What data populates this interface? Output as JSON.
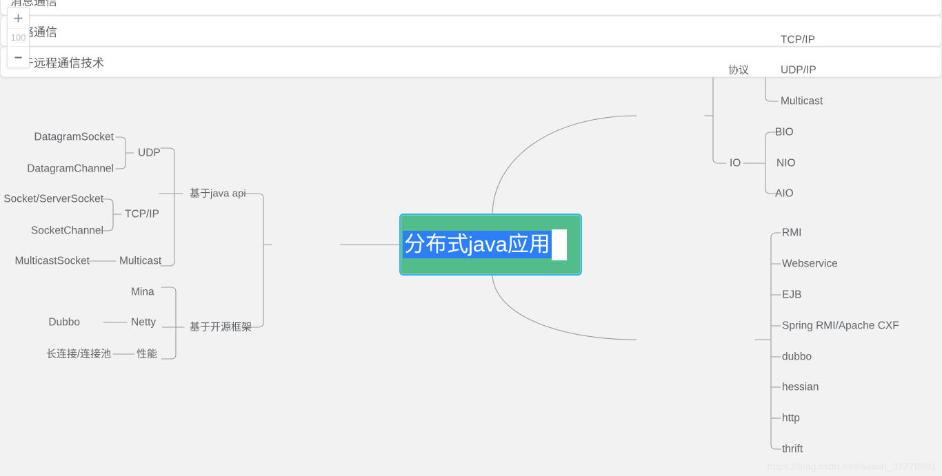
{
  "app": {
    "background_color": "#f2f2f2",
    "line_color": "#9a9a9a",
    "text_color": "#606468"
  },
  "zoom_control": {
    "zoom_in_label": "+",
    "zoom_level": "100",
    "zoom_out_label": "−",
    "zoom_in_icon": "plus-icon",
    "zoom_out_icon": "minus-icon"
  },
  "root": {
    "text": "分布式java应用",
    "state": "editing-selected",
    "fill_color": "#52bd8a",
    "border_color": "#2fb4ef",
    "selection_color": "#2d7ff9",
    "text_color": "#ffffff"
  },
  "branches": [
    {
      "id": "message-communication",
      "label": "消息通信",
      "side": "left",
      "style": "box",
      "children": [
        {
          "label": "基于java api",
          "children": [
            {
              "label": "UDP",
              "children": [
                {
                  "label": "DatagramSocket"
                },
                {
                  "label": "DatagramChannel"
                }
              ]
            },
            {
              "label": "TCP/IP",
              "children": [
                {
                  "label": "Socket/ServerSocket"
                },
                {
                  "label": "SocketChannel"
                }
              ]
            },
            {
              "label": "Multicast",
              "children": [
                {
                  "label": "MulticastSocket"
                }
              ]
            }
          ]
        },
        {
          "label": "基于开源框架",
          "children": [
            {
              "label": "Mina"
            },
            {
              "label": "Netty",
              "children": [
                {
                  "label": "Dubbo"
                }
              ]
            },
            {
              "label": "性能",
              "children": [
                {
                  "label": "长连接/连接池"
                }
              ]
            }
          ]
        }
      ]
    },
    {
      "id": "network-communication",
      "label": "网络通信",
      "side": "right",
      "style": "box",
      "children": [
        {
          "label": "协议",
          "children": [
            {
              "label": "TCP/IP"
            },
            {
              "label": "UDP/IP"
            },
            {
              "label": "Multicast"
            }
          ]
        },
        {
          "label": "IO",
          "children": [
            {
              "label": "BIO"
            },
            {
              "label": "NIO"
            },
            {
              "label": "AIO"
            }
          ]
        }
      ]
    },
    {
      "id": "remote-communication-tech",
      "label": "基于远程通信技术",
      "side": "right",
      "style": "box",
      "children": [
        {
          "label": "RMI"
        },
        {
          "label": "Webservice"
        },
        {
          "label": "EJB"
        },
        {
          "label": "Spring RMI/Apache CXF"
        },
        {
          "label": "dubbo"
        },
        {
          "label": "hessian"
        },
        {
          "label": "http"
        },
        {
          "label": "thrift"
        }
      ]
    }
  ],
  "watermark": {
    "text": "https://blog.csdn.net/weixin_37778801"
  }
}
